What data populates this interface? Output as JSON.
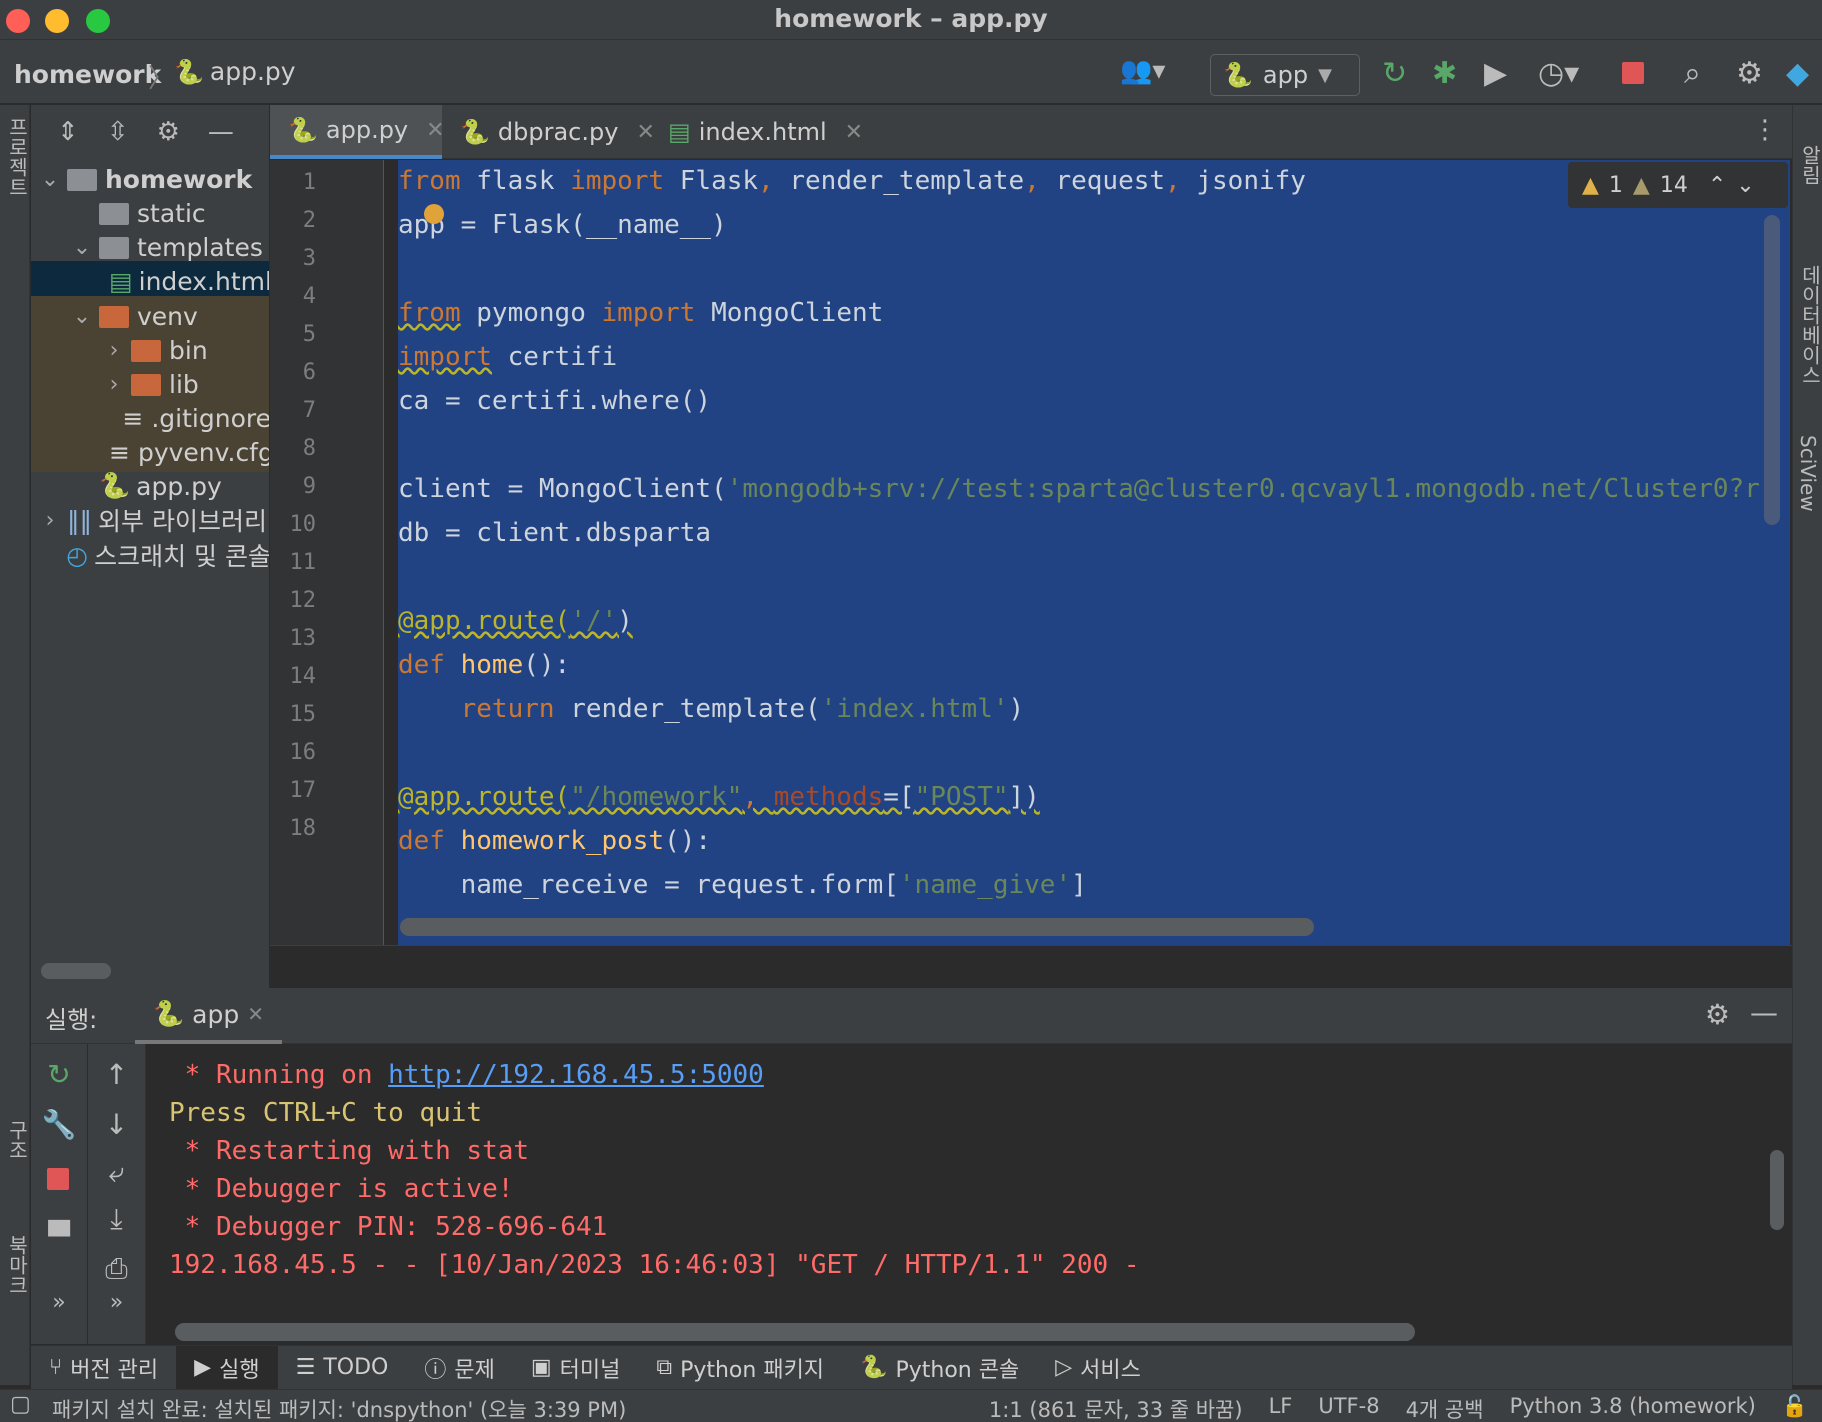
{
  "window": {
    "title": "homework – app.py"
  },
  "navbar": {
    "project": "homework",
    "file": "app.py",
    "run_config": "app"
  },
  "left_stripe": {
    "project_label": "프로젝트",
    "structure_label": "구조",
    "bookmarks_label": "북마크"
  },
  "right_stripe": {
    "notifications_label": "알림",
    "database_label": "데이터베이스",
    "sciview_label": "SciView"
  },
  "project_tree": [
    {
      "label": "homework",
      "kind": "folder",
      "depth": 0,
      "expanded": true
    },
    {
      "label": "static",
      "kind": "folder",
      "depth": 1
    },
    {
      "label": "templates",
      "kind": "folder",
      "depth": 1,
      "expanded": true
    },
    {
      "label": "index.html",
      "kind": "html",
      "depth": 2,
      "selected": true
    },
    {
      "label": "venv",
      "kind": "folder-orange",
      "depth": 1,
      "expanded": true
    },
    {
      "label": "bin",
      "kind": "folder-orange",
      "depth": 2,
      "collapsed": true
    },
    {
      "label": "lib",
      "kind": "folder-orange",
      "depth": 2,
      "collapsed": true
    },
    {
      "label": ".gitignore",
      "kind": "file",
      "depth": 2
    },
    {
      "label": "pyvenv.cfg",
      "kind": "file",
      "depth": 2
    },
    {
      "label": "app.py",
      "kind": "python",
      "depth": 1
    },
    {
      "label": "외부 라이브러리",
      "kind": "library",
      "depth": 0,
      "collapsed": true
    },
    {
      "label": "스크래치 및 콘솔",
      "kind": "scratch",
      "depth": 0
    }
  ],
  "editor_tabs": [
    {
      "label": "app.py",
      "active": true
    },
    {
      "label": "dbprac.py",
      "active": false
    },
    {
      "label": "index.html",
      "active": false
    }
  ],
  "inspections": {
    "errors": "1",
    "warnings": "14"
  },
  "line_numbers": [
    "1",
    "2",
    "3",
    "4",
    "5",
    "6",
    "7",
    "8",
    "9",
    "10",
    "11",
    "12",
    "13",
    "14",
    "15",
    "16",
    "17",
    "18"
  ],
  "run_panel": {
    "label": "실행:",
    "tab": "app",
    "console": {
      "running_prefix": " * Running on ",
      "running_url": "http://192.168.45.5:5000",
      "quit": "Press CTRL+C to quit",
      "restart": " * Restarting with stat",
      "debugger_active": " * Debugger is active!",
      "debugger_pin": " * Debugger PIN: 528-696-641",
      "request_log": "192.168.45.5 - - [10/Jan/2023 16:46:03] \"GET / HTTP/1.1\" 200 -"
    }
  },
  "bottom_tabs": [
    "버전 관리",
    "실행",
    "TODO",
    "문제",
    "터미널",
    "Python 패키지",
    "Python 콘솔",
    "서비스"
  ],
  "statusbar": {
    "message": "패키지 설치 완료: 설치된 패키지: 'dnspython' (오늘 3:39 PM)",
    "position": "1:1 (861 문자, 33 줄 바꿈)",
    "line_sep": "LF",
    "encoding": "UTF-8",
    "indent": "4개 공백",
    "interpreter": "Python 3.8 (homework)"
  },
  "colors": {
    "selection": "#214283",
    "keyword": "#cc7832",
    "string": "#6a8759",
    "function": "#ffc66d",
    "console_red": "#ff6b68"
  }
}
